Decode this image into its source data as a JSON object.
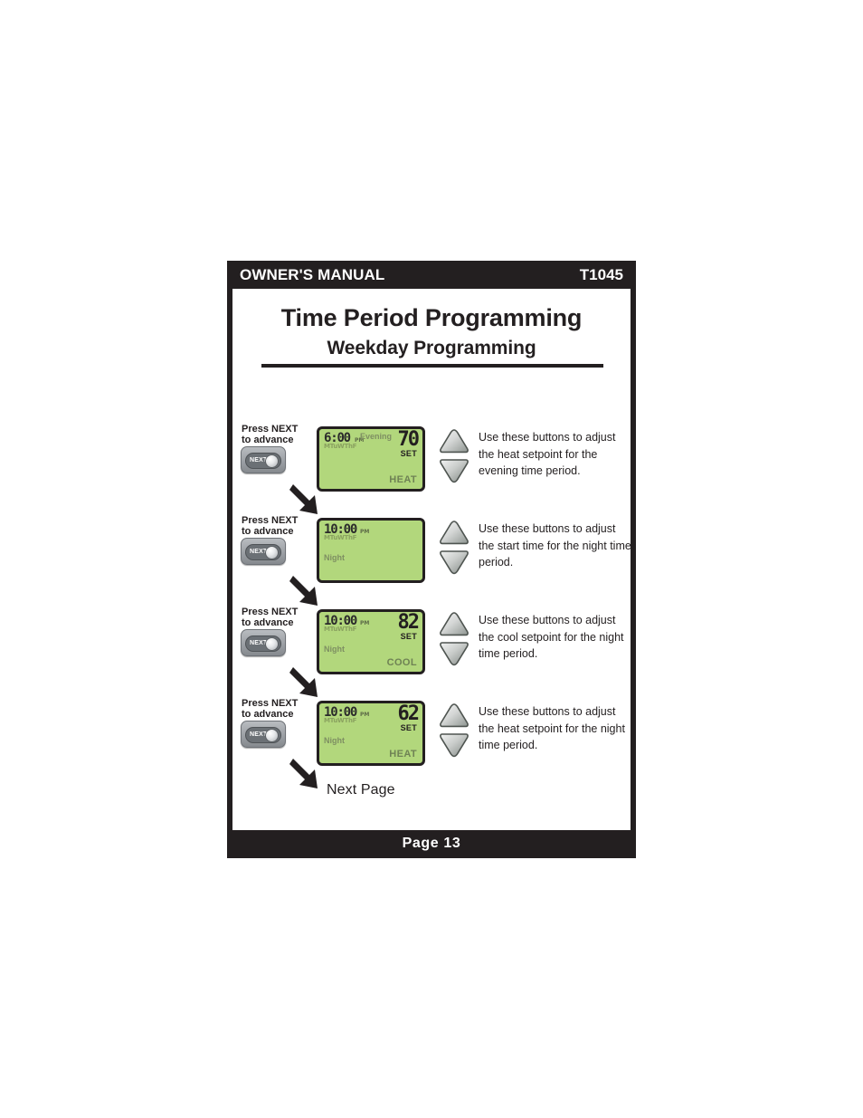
{
  "header": {
    "manual_label": "OWNER'S MANUAL",
    "model": "T1045"
  },
  "footer": {
    "page_label": "Page 13"
  },
  "titles": {
    "main": "Time Period Programming",
    "sub": "Weekday Programming"
  },
  "flow": {
    "next_page_label": "Next Page",
    "press_line1": "Press NEXT",
    "press_line2": "to advance",
    "next_button_label": "NEXT"
  },
  "colors": {
    "bar": "#231f20",
    "lcd_green": "#b2d77c",
    "lcd_dim_text": "#8aa25f",
    "lcd_dark_text": "#231f20",
    "button_gray": "#a0a4a9"
  },
  "steps": [
    {
      "press_line1": "Press NEXT",
      "press_line2": "to advance",
      "next_button_label": "NEXT",
      "lcd": {
        "time": "6:00",
        "ampm": "PM",
        "days": "MTuWThF",
        "period_right": "Evening",
        "period_left": "",
        "setpoint": "70",
        "set_label": "SET",
        "mode": "HEAT"
      },
      "instruction": "Use these buttons to adjust the heat setpoint for the evening time period."
    },
    {
      "press_line1": "Press NEXT",
      "press_line2": "to advance",
      "next_button_label": "NEXT",
      "lcd": {
        "time": "10:00",
        "ampm": "PM",
        "days": "MTuWThF",
        "period_right": "",
        "period_left": "Night",
        "setpoint": "",
        "set_label": "",
        "mode": ""
      },
      "instruction": "Use these buttons to adjust the start time for the night time period."
    },
    {
      "press_line1": "Press NEXT",
      "press_line2": "to advance",
      "next_button_label": "NEXT",
      "lcd": {
        "time": "10:00",
        "ampm": "PM",
        "days": "MTuWThF",
        "period_right": "",
        "period_left": "Night",
        "setpoint": "82",
        "set_label": "SET",
        "mode": "COOL"
      },
      "instruction": "Use these buttons to adjust the cool setpoint for the night time period."
    },
    {
      "press_line1": "Press NEXT",
      "press_line2": "to advance",
      "next_button_label": "NEXT",
      "lcd": {
        "time": "10:00",
        "ampm": "PM",
        "days": "MTuWThF",
        "period_right": "",
        "period_left": "Night",
        "setpoint": "62",
        "set_label": "SET",
        "mode": "HEAT"
      },
      "instruction": "Use these buttons to adjust the heat setpoint for the night time period."
    }
  ]
}
